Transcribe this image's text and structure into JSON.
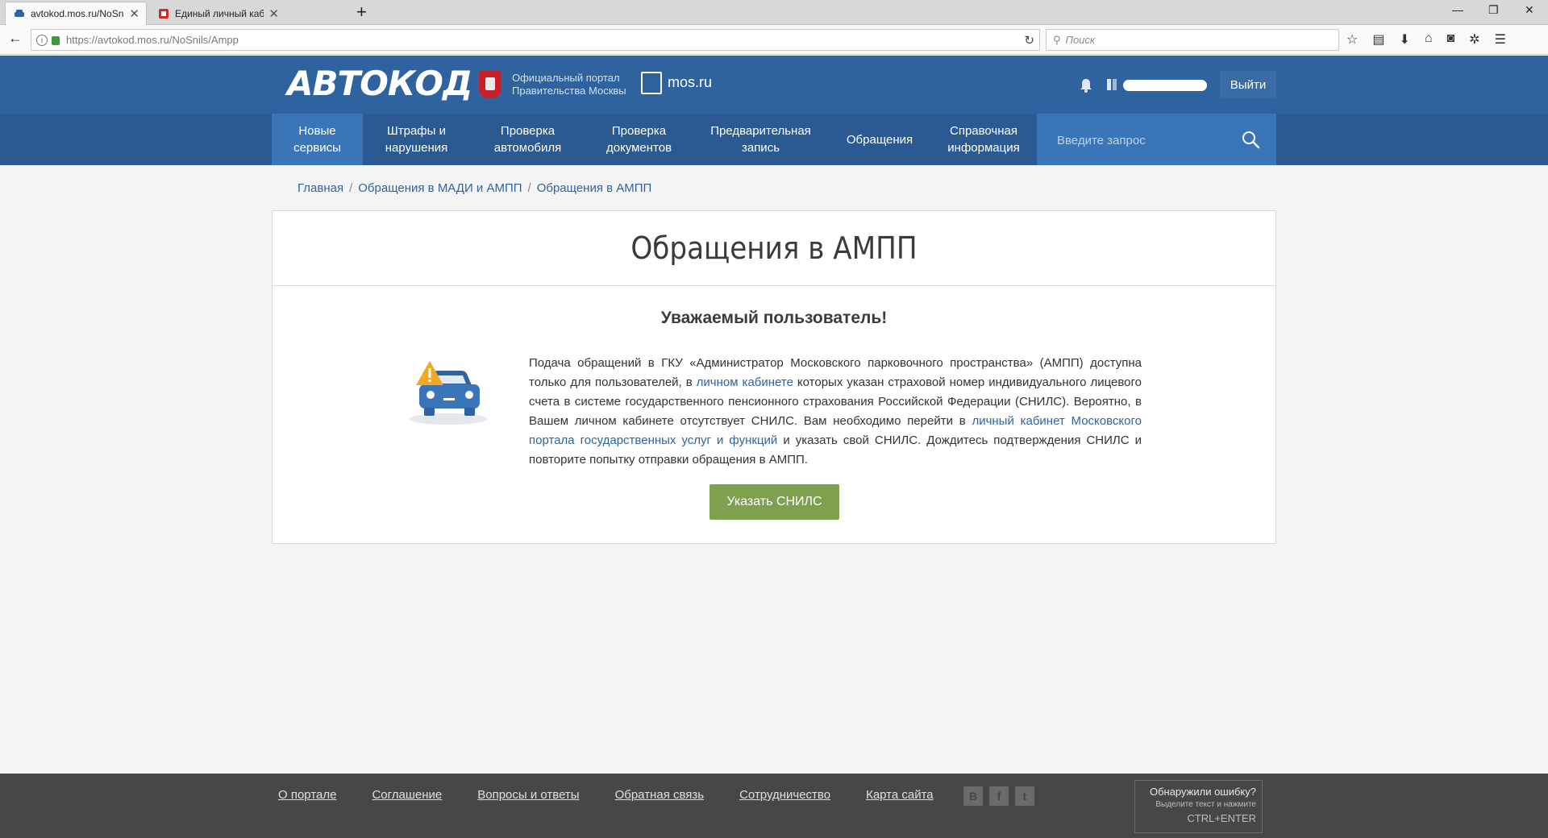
{
  "browser": {
    "tabs": [
      {
        "label": "avtokod.mos.ru/NoSnils/Ampp",
        "active": true
      },
      {
        "label": "Единый личный кабинет",
        "active": false
      }
    ],
    "new_tab": "+",
    "url": "https://avtokod.mos.ru/NoSnils/Ampp",
    "search_placeholder": "Поиск",
    "window_controls": {
      "minimize": "—",
      "restore": "❐",
      "close": "✕"
    }
  },
  "header": {
    "logo": "АВТОКОД",
    "portal_line1": "Официальный портал",
    "portal_line2": "Правительства Москвы",
    "mosru": "mos.ru",
    "logout": "Выйти"
  },
  "nav": {
    "items": [
      {
        "line1": "Новые",
        "line2": "сервисы"
      },
      {
        "line1": "Штрафы и",
        "line2": "нарушения"
      },
      {
        "line1": "Проверка",
        "line2": "автомобиля"
      },
      {
        "line1": "Проверка",
        "line2": "документов"
      },
      {
        "line1": "Предварительная",
        "line2": "запись"
      },
      {
        "line1": "Обращения",
        "line2": ""
      },
      {
        "line1": "Справочная",
        "line2": "информация"
      }
    ],
    "search_placeholder": "Введите запрос"
  },
  "breadcrumb": {
    "items": [
      "Главная",
      "Обращения в МАДИ и АМПП",
      "Обращения в АМПП"
    ],
    "separator": "/"
  },
  "card": {
    "title": "Обращения в АМПП",
    "greeting": "Уважаемый пользователь!",
    "message": {
      "p1": "Подача обращений в ГКУ «Администратор Московского парковочного пространства» (АМПП) доступна только для пользователей, в ",
      "link1": "личном кабинете",
      "p2": " которых указан страховой номер индивидуального лицевого счета в системе государственного пенсионного страхования Российской Федерации (СНИЛС). Вероятно, в Вашем личном кабинете отсутствует СНИЛС. Вам необходимо перейти в ",
      "link2": "личный кабинет Московского портала государственных услуг и функций",
      "p3": " и указать свой СНИЛС. Дождитесь подтверждения СНИЛС и повторите попытку отправки обращения в АМПП."
    },
    "button": "Указать СНИЛС"
  },
  "footer": {
    "links": [
      "О портале",
      "Соглашение",
      "Вопросы и ответы",
      "Обратная связь",
      "Сотрудничество",
      "Карта сайта"
    ],
    "social": [
      "В",
      "f",
      "t"
    ],
    "error_title": "Обнаружили ошибку?",
    "error_hint": "Выделите текст и нажмите",
    "error_keys": "CTRL+ENTER"
  },
  "colors": {
    "header_bg": "#2f63a0",
    "nav_bg": "#2b5a93",
    "nav_active": "#3a76b7",
    "button_green": "#7fa04e",
    "footer_bg": "#474747"
  }
}
